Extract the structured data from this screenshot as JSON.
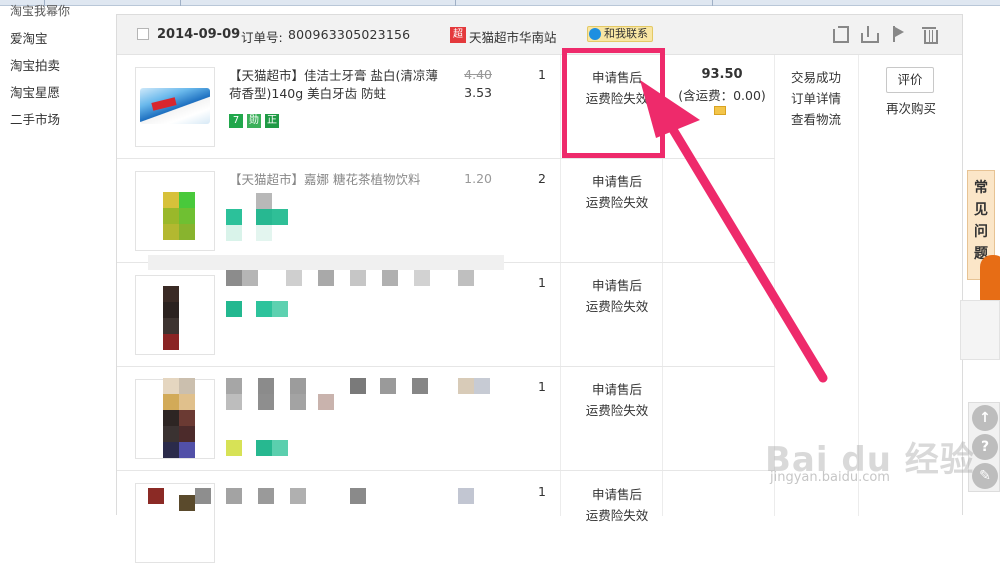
{
  "sidebar": {
    "cut_label": "淘宝我幂你",
    "items": [
      "爱淘宝",
      "淘宝拍卖",
      "淘宝星愿",
      "二手市场"
    ]
  },
  "order": {
    "date": "2014-09-09",
    "order_no_label": "订单号:",
    "order_no": "800963305023156",
    "shop_badge": "超",
    "shop_name": "天猫超市华南站",
    "contact_label": "和我联系",
    "first_item": {
      "title": "【天猫超市】佳洁士牙膏 盐白(清凉薄荷香型)140g 美白牙齿 防蛀",
      "tags": [
        "7",
        "勋",
        "正"
      ],
      "original_price": "4.40",
      "price": "3.53",
      "qty": "1"
    },
    "second_item": {
      "title_partial": "【天猫超市】嘉娜 糖花茶植物饮料",
      "price_partial": "1.20",
      "qty": "2"
    },
    "other_qtys": [
      "1",
      "1",
      "1"
    ],
    "service": {
      "apply_after_sale": "申请售后",
      "insurance_expired": "运费险失效"
    },
    "total": "93.50",
    "shipping_note": "(含运费：0.00)",
    "status": {
      "success": "交易成功",
      "details": "订单详情",
      "logistics": "查看物流"
    },
    "actions": {
      "review": "评价",
      "rebuy": "再次购买"
    }
  },
  "side_panel": {
    "faq": [
      "常",
      "见",
      "问",
      "题"
    ],
    "buttons": [
      "↑",
      "?",
      "✎"
    ]
  },
  "watermark": {
    "brand": "Bai du 经验",
    "url": "jingyan.baidu.com"
  },
  "colors": {
    "highlight": "#ee2a6b",
    "shop_red": "#e4393c",
    "tag_green": "#20a84a",
    "contact_bg": "#f8e6a3"
  }
}
